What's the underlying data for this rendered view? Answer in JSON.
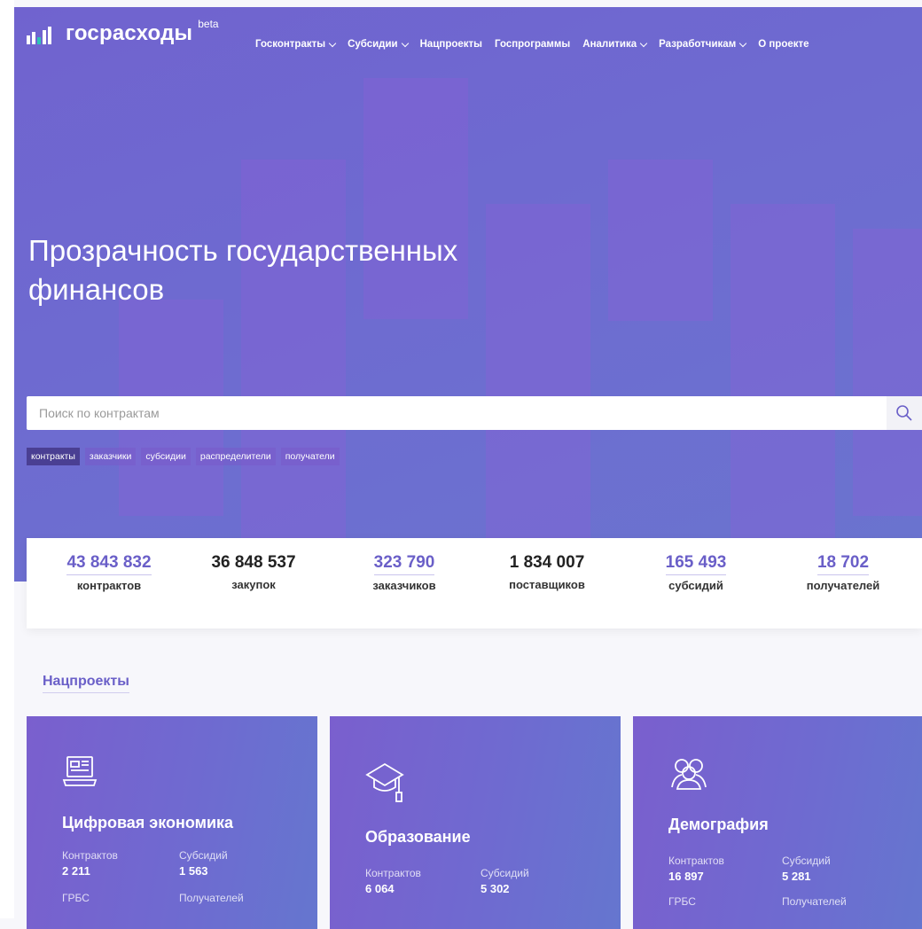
{
  "brand": {
    "name": "госрасходы",
    "badge": "beta"
  },
  "nav": [
    {
      "label": "Госконтракты",
      "dropdown": true
    },
    {
      "label": "Субсидии",
      "dropdown": true
    },
    {
      "label": "Нацпроекты",
      "dropdown": false
    },
    {
      "label": "Госпрограммы",
      "dropdown": false
    },
    {
      "label": "Аналитика",
      "dropdown": true
    },
    {
      "label": "Разработчикам",
      "dropdown": true
    },
    {
      "label": "О проекте",
      "dropdown": false
    }
  ],
  "hero": {
    "title_line1": "Прозрачность государственных",
    "title_line2": "финансов"
  },
  "search": {
    "placeholder": "Поиск по контрактам",
    "icon": "search-icon"
  },
  "search_tabs": [
    {
      "label": "контракты",
      "active": true
    },
    {
      "label": "заказчики",
      "active": false
    },
    {
      "label": "субсидии",
      "active": false
    },
    {
      "label": "распределители",
      "active": false
    },
    {
      "label": "получатели",
      "active": false
    }
  ],
  "stats": [
    {
      "value": "43 843 832",
      "label": "контрактов",
      "link": true
    },
    {
      "value": "36 848 537",
      "label": "закупок",
      "link": false
    },
    {
      "value": "323 790",
      "label": "заказчиков",
      "link": true
    },
    {
      "value": "1 834 007",
      "label": "поставщиков",
      "link": false
    },
    {
      "value": "165 493",
      "label": "субсидий",
      "link": true
    },
    {
      "value": "18 702",
      "label": "получателей",
      "link": true
    }
  ],
  "section": {
    "title": "Нацпроекты"
  },
  "cards": [
    {
      "title": "Цифровая экономика",
      "icon": "laptop-icon",
      "stats": [
        {
          "label": "Контрактов",
          "value": "2 211"
        },
        {
          "label": "Субсидий",
          "value": "1 563"
        },
        {
          "label": "ГРБС",
          "value": ""
        },
        {
          "label": "Получателей",
          "value": ""
        }
      ]
    },
    {
      "title": "Образование",
      "icon": "graduation-cap-icon",
      "stats": [
        {
          "label": "Контрактов",
          "value": "6 064"
        },
        {
          "label": "Субсидий",
          "value": "5 302"
        }
      ]
    },
    {
      "title": "Демография",
      "icon": "people-icon",
      "stats": [
        {
          "label": "Контрактов",
          "value": "16 897"
        },
        {
          "label": "Субсидий",
          "value": "5 281"
        },
        {
          "label": "ГРБС",
          "value": ""
        },
        {
          "label": "Получателей",
          "value": ""
        }
      ]
    }
  ],
  "colors": {
    "accent": "#6a5fc8",
    "hero": "#6e6bd0",
    "active_tab": "#4a3f93",
    "logo_teal": "#2ec4b6"
  }
}
